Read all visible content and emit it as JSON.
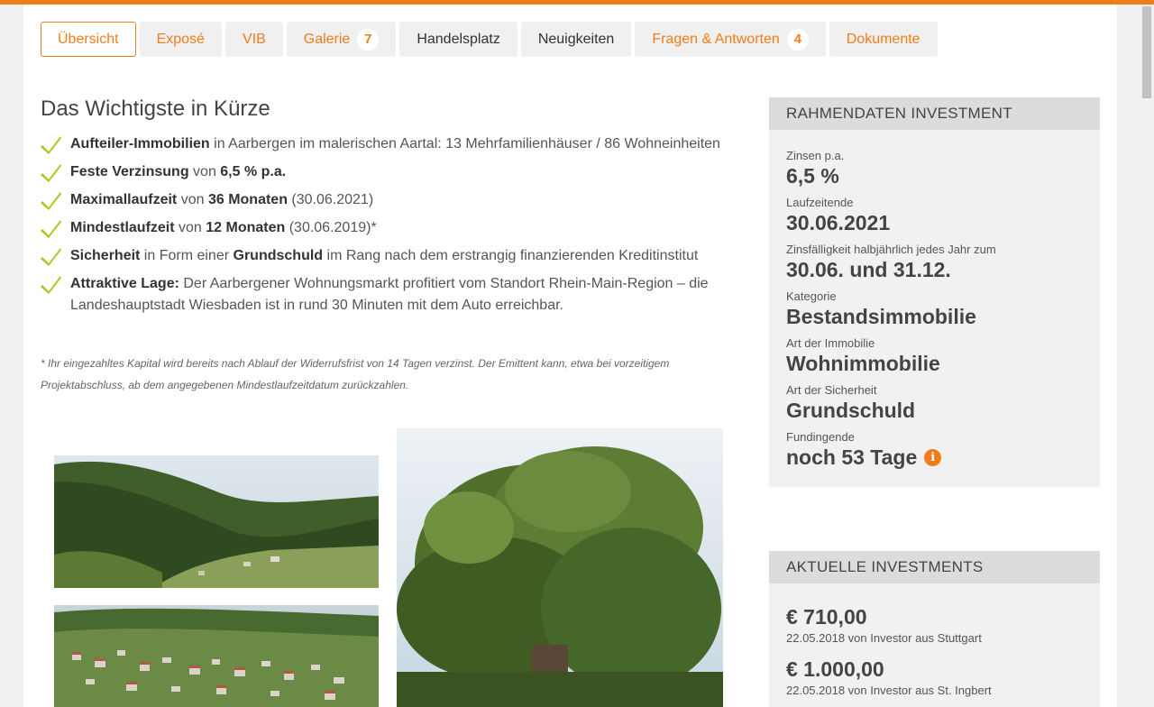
{
  "tabs": [
    {
      "label": "Übersicht",
      "badge": null,
      "active": true,
      "style": "orange"
    },
    {
      "label": "Exposé",
      "badge": null,
      "active": false,
      "style": "orange"
    },
    {
      "label": "VIB",
      "badge": null,
      "active": false,
      "style": "orange"
    },
    {
      "label": "Galerie",
      "badge": "7",
      "active": false,
      "style": "orange"
    },
    {
      "label": "Handelsplatz",
      "badge": null,
      "active": false,
      "style": "dark"
    },
    {
      "label": "Neuigkeiten",
      "badge": null,
      "active": false,
      "style": "dark"
    },
    {
      "label": "Fragen & Antworten",
      "badge": "4",
      "active": false,
      "style": "orange"
    },
    {
      "label": "Dokumente",
      "badge": null,
      "active": false,
      "style": "orange"
    }
  ],
  "summary": {
    "title": "Das Wichtigste in Kürze",
    "items": [
      [
        {
          "b": true,
          "t": "Aufteiler-Immobilien"
        },
        {
          "b": false,
          "t": " in Aarbergen im malerischen Aartal: 13 Mehrfamilienhäuser / 86 Wohneinheiten"
        }
      ],
      [
        {
          "b": true,
          "t": "Feste Verzinsung"
        },
        {
          "b": false,
          "t": " von "
        },
        {
          "b": true,
          "t": "6,5 % p.a."
        }
      ],
      [
        {
          "b": true,
          "t": "Maximallaufzeit"
        },
        {
          "b": false,
          "t": " von "
        },
        {
          "b": true,
          "t": "36 Monaten"
        },
        {
          "b": false,
          "t": " (30.06.2021)"
        }
      ],
      [
        {
          "b": true,
          "t": "Mindestlaufzeit"
        },
        {
          "b": false,
          "t": " von "
        },
        {
          "b": true,
          "t": "12 Monaten"
        },
        {
          "b": false,
          "t": " (30.06.2019)*"
        }
      ],
      [
        {
          "b": true,
          "t": "Sicherheit"
        },
        {
          "b": false,
          "t": " in Form einer "
        },
        {
          "b": true,
          "t": "Grundschuld"
        },
        {
          "b": false,
          "t": " im Rang nach dem erstrangig finanzierenden Kreditinstitut"
        }
      ],
      [
        {
          "b": true,
          "t": "Attraktive Lage:"
        },
        {
          "b": false,
          "t": " Der Aarbergener Wohnungsmarkt profitiert vom Standort Rhein-Main-Region – die Landeshauptstadt Wiesbaden ist in rund 30 Minuten mit dem Auto erreichbar."
        }
      ]
    ],
    "footnote": "* Ihr eingezahltes Kapital wird bereits nach Ablauf der Widerrufsfrist von 14 Tagen verzinst. Der Emittent kann, etwa bei vorzeitigem Projektabschluss, ab dem angegebenen Mindestlaufzeitdatum zurückzahlen."
  },
  "rahmendaten": {
    "title": "RAHMENDATEN INVESTMENT",
    "rows": [
      {
        "label": "Zinsen p.a.",
        "value": "6,5 %"
      },
      {
        "label": "Laufzeitende",
        "value": "30.06.2021"
      },
      {
        "label": "Zinsfälligkeit halbjährlich jedes Jahr zum",
        "value": "30.06. und 31.12."
      },
      {
        "label": "Kategorie",
        "value": "Bestandsimmobilie"
      },
      {
        "label": "Art der Immobilie",
        "value": "Wohnimmobilie"
      },
      {
        "label": "Art der Sicherheit",
        "value": "Grundschuld"
      },
      {
        "label": "Fundingende",
        "value": "noch 53 Tage",
        "info": true
      }
    ]
  },
  "investments": {
    "title": "AKTUELLE INVESTMENTS",
    "items": [
      {
        "amount": "€ 710,00",
        "meta": "22.05.2018 von Investor aus Stuttgart"
      },
      {
        "amount": "€ 1.000,00",
        "meta": "22.05.2018 von Investor aus St. Ingbert"
      }
    ]
  },
  "colors": {
    "accent": "#f07d1a",
    "check": "#a8c81c",
    "panel": "#f1f1f1",
    "panel_head": "#dcdcdc"
  },
  "icons": {
    "check": "check-icon",
    "info": "info-icon"
  }
}
